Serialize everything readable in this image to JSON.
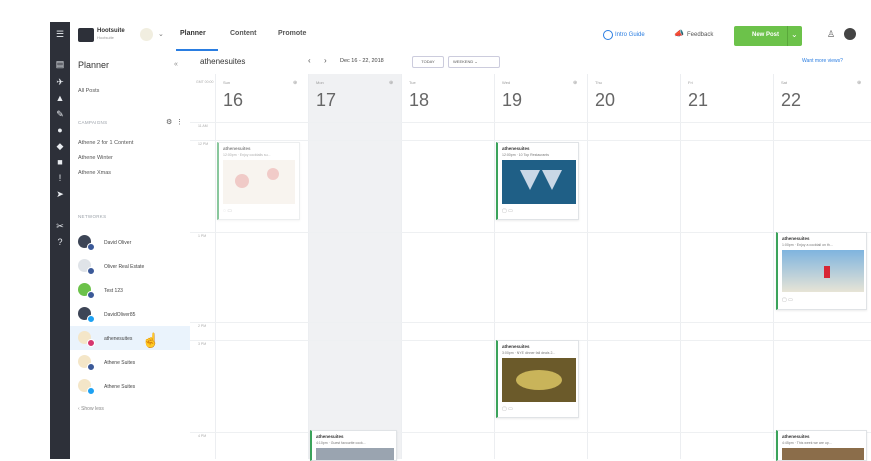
{
  "header": {
    "brand_name": "Hootsuite",
    "brand_sub": "Hootsuite",
    "tabs": [
      {
        "label": "Planner",
        "active": true
      },
      {
        "label": "Content",
        "active": false
      },
      {
        "label": "Promote",
        "active": false
      }
    ],
    "intro_guide": "Intro Guide",
    "feedback": "Feedback",
    "new_post": "New Post"
  },
  "sidebar": {
    "title": "Planner",
    "all_posts": "All Posts",
    "campaigns_label": "CAMPAIGNS",
    "campaigns": [
      "Athene 2 for 1 Content",
      "Athene Winter",
      "Athene Xmas"
    ],
    "networks_label": "NETWORKS",
    "networks": [
      {
        "name": "David Oliver",
        "badge": "fb"
      },
      {
        "name": "Oliver Real Estate",
        "badge": "fb"
      },
      {
        "name": "Test 123",
        "badge": "fb"
      },
      {
        "name": "DavidOliver85",
        "badge": "tw"
      },
      {
        "name": "athenesuites",
        "badge": "ig",
        "selected": true
      },
      {
        "name": "Athene Suites",
        "badge": "fb"
      },
      {
        "name": "Athene Suites",
        "badge": "tw"
      }
    ],
    "show_less": "Show less"
  },
  "calendar": {
    "account": "athenesuites",
    "date_range": "Dec 16 - 22, 2018",
    "today_btn": "TODAY",
    "view_select": "WEEKEND",
    "want_more": "Want more views?",
    "gmt": "GMT 00:00",
    "days": [
      {
        "name": "Sun",
        "num": "16"
      },
      {
        "name": "Mon",
        "num": "17"
      },
      {
        "name": "Tue",
        "num": "18"
      },
      {
        "name": "Wed",
        "num": "19"
      },
      {
        "name": "Thu",
        "num": "20"
      },
      {
        "name": "Fri",
        "num": "21"
      },
      {
        "name": "Sat",
        "num": "22"
      }
    ],
    "times": [
      "11 AM",
      "12 PM",
      "1 PM",
      "2 PM",
      "3 PM",
      "4 PM"
    ],
    "posts": [
      {
        "account": "athenesuites",
        "time": "12:00pm · Enjoy cocktails su..."
      },
      {
        "account": "athenesuites",
        "time": "12:00pm · 10 Top Restaurants"
      },
      {
        "account": "athenesuites",
        "time": "1:00pm · Enjoy a cocktail on th..."
      },
      {
        "account": "athenesuites",
        "time": "3:00pm · NYE dinner fall deals 2..."
      },
      {
        "account": "athenesuites",
        "time": "4:10pm · Guest favourite cock..."
      },
      {
        "account": "athenesuites",
        "time": "4:45pm · This week we are up..."
      }
    ]
  },
  "colors": {
    "accent": "#2a7de1",
    "new_post": "#6cc24a",
    "rail": "#2d3039",
    "card_border": "#3ba35b",
    "selected_row": "#eaf3fc"
  }
}
